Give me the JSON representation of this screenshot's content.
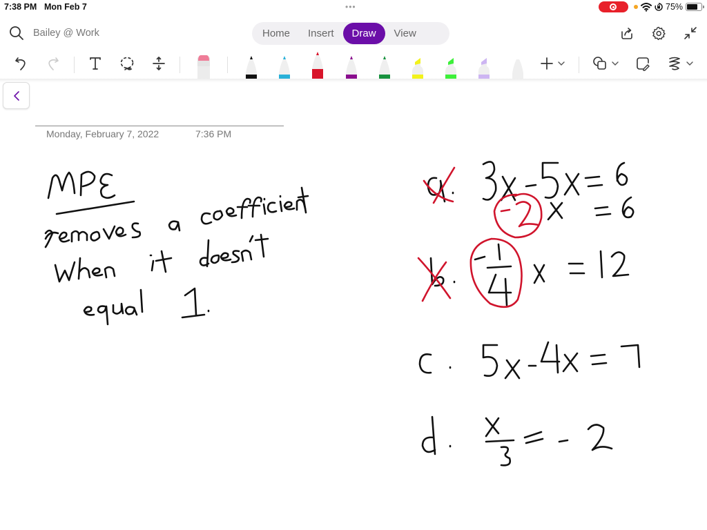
{
  "status_bar": {
    "time": "7:38 PM",
    "date": "Mon Feb 7",
    "multitask_dots": "•••",
    "battery_percent": "75%",
    "battery_level": 0.75
  },
  "header": {
    "notebook_name": "Bailey @ Work",
    "tabs": [
      {
        "label": "Home",
        "active": false
      },
      {
        "label": "Insert",
        "active": false
      },
      {
        "label": "Draw",
        "active": true
      },
      {
        "label": "View",
        "active": false
      }
    ],
    "icons": [
      "share-icon",
      "settings-gear-icon",
      "collapse-arrows-icon"
    ]
  },
  "toolbar": {
    "tools": [
      "undo-icon",
      "redo-icon",
      "text-tool-icon",
      "lasso-select-icon",
      "insert-space-icon",
      "eraser-icon"
    ],
    "pens": [
      {
        "name": "black-pen",
        "color": "#111111",
        "type": "pen"
      },
      {
        "name": "cyan-pen",
        "color": "#29b0d8",
        "type": "pen"
      },
      {
        "name": "red-pen",
        "color": "#d8142a",
        "type": "pen",
        "selected": true
      },
      {
        "name": "purple-pen",
        "color": "#8a0e8e",
        "type": "pen"
      },
      {
        "name": "green-pen",
        "color": "#18923e",
        "type": "pen"
      },
      {
        "name": "yellow-highlighter",
        "color": "#f2f21c",
        "type": "highlighter"
      },
      {
        "name": "green-highlighter",
        "color": "#3df03a",
        "type": "highlighter"
      },
      {
        "name": "lavender-highlighter",
        "color": "#cdb5f2",
        "type": "highlighter"
      },
      {
        "name": "empty-pen-slot",
        "color": "#e6e6e6",
        "type": "pen"
      }
    ],
    "right_tools": [
      "add-pen-icon",
      "shapes-icon",
      "ink-to-text-icon",
      "ink-to-shape-icon"
    ]
  },
  "page": {
    "date": "Monday, February 7, 2022",
    "time": "7:36 PM",
    "ink_notes": {
      "heading": "MPE",
      "definition": "removes a coefficient when it doesn't equal 1.",
      "problems": [
        {
          "label": "a.",
          "crossed_out": true,
          "lines": [
            "3x - 5x = 6",
            "-2x = 6"
          ],
          "circled": "-2"
        },
        {
          "label": "b.",
          "crossed_out": true,
          "lines": [
            "-1/4 x = 12"
          ],
          "circled": "-1/4"
        },
        {
          "label": "c.",
          "crossed_out": false,
          "lines": [
            "5x - 4x = 7"
          ]
        },
        {
          "label": "d.",
          "crossed_out": false,
          "lines": [
            "x/3 = -2"
          ]
        }
      ]
    }
  },
  "colors": {
    "accent": "#6b0ea8",
    "ink_black": "#111111",
    "ink_red": "#d0142c"
  }
}
